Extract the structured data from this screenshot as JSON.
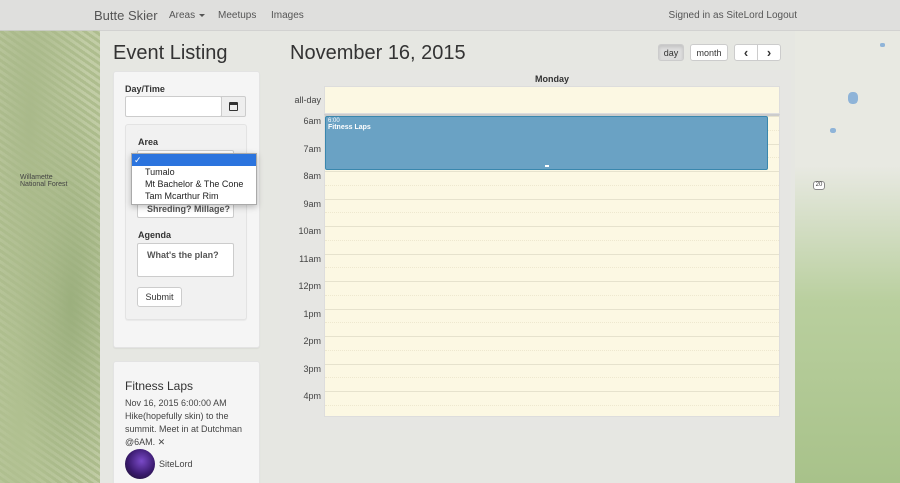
{
  "navbar": {
    "brand": "Butte Skier",
    "areas_label": "Areas",
    "meetups_label": "Meetups",
    "images_label": "Images",
    "signed_in": "Signed in as SiteLord",
    "logout": "Logout"
  },
  "left": {
    "title": "Event Listing",
    "form": {
      "daytime_label": "Day/Time",
      "daytime_value": "",
      "area_label": "Area",
      "area_options": [
        "✓",
        "Tumalo",
        "Mt Bachelor & The Cone",
        "Tam Mcarthur Rim"
      ],
      "description_placeholder": "Shreding? Millage?",
      "agenda_label": "Agenda",
      "agenda_placeholder": "What's the plan?",
      "submit": "Submit"
    },
    "event_detail": {
      "title": "Fitness Laps",
      "date": "Nov 16, 2015 6:00:00 AM",
      "desc_line1": "Hike(hopefully skin) to the",
      "desc_line2": "summit. Meet in at Dutchman",
      "desc_line3": "@6AM.",
      "close": "✕",
      "user": "SiteLord"
    }
  },
  "calendar": {
    "title": "November 16, 2015",
    "buttons": {
      "day": "day",
      "month": "month",
      "prev": "‹",
      "next": "›"
    },
    "day_header": "Monday",
    "allday_label": "all-day",
    "times": [
      "6am",
      "7am",
      "8am",
      "9am",
      "10am",
      "11am",
      "12pm",
      "1pm",
      "2pm",
      "3pm",
      "4pm"
    ],
    "event": {
      "time": "6:00",
      "title": "Fitness Laps"
    }
  },
  "map": {
    "label_forest": "Willamette National Forest",
    "road": "20"
  },
  "colors": {
    "event": "#6aa2c4",
    "grid_bg": "#fcf8e3",
    "selected": "#2b74de"
  }
}
